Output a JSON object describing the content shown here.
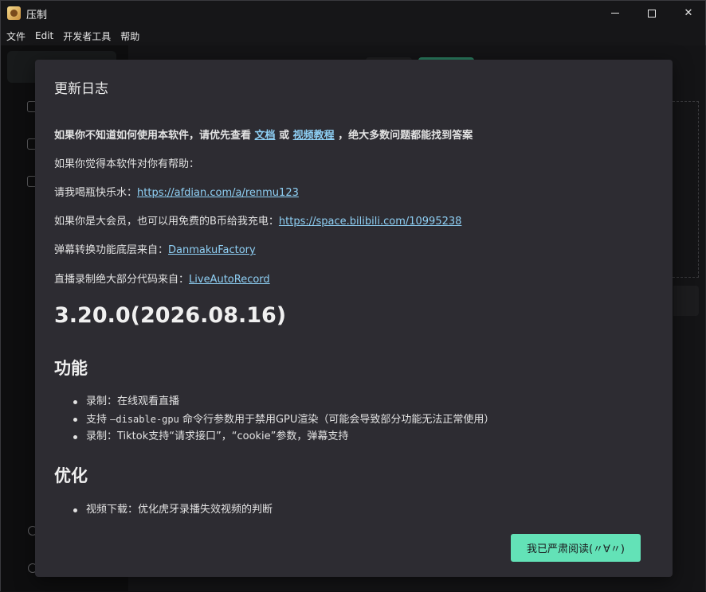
{
  "window": {
    "title": "压制",
    "minimize_label": "minimize",
    "maximize_label": "maximize",
    "close_label": "✕"
  },
  "menu": [
    "文件",
    "Edit",
    "开发者工具",
    "帮助"
  ],
  "modal": {
    "title": "更新日志",
    "intro": {
      "prefix": "如果你不知道如何使用本软件，请优先查看 ",
      "link1": "文档",
      "middle": " 或 ",
      "link2": "视频教程",
      "suffix": " ，绝大多数问题都能找到答案"
    },
    "help_line": "如果你觉得本软件对你有帮助：",
    "donate": {
      "label": "请我喝瓶快乐水：",
      "url": "https://afdian.com/a/renmu123"
    },
    "charge": {
      "label": "如果你是大会员，也可以用免费的B币给我充电：",
      "url": "https://space.bilibili.com/10995238"
    },
    "danmaku": {
      "label": "弹幕转换功能底层来自：",
      "link": "DanmakuFactory"
    },
    "record": {
      "label": "直播录制绝大部分代码来自：",
      "link": "LiveAutoRecord"
    },
    "version": "3.20.0(2026.08.16)",
    "features_heading": "功能",
    "features": [
      {
        "pre": "录制：在线观看直播",
        "code": "",
        "post": ""
      },
      {
        "pre": "支持 ",
        "code": "—disable-gpu",
        "post": " 命令行参数用于禁用GPU渲染（可能会导致部分功能无法正常使用）"
      },
      {
        "pre": "录制：Tiktok支持“请求接口”，“cookie”参数，弹幕支持",
        "code": "",
        "post": ""
      }
    ],
    "optimize_heading": "优化",
    "optimizations": [
      "视频下载：优化虎牙录播失效视频的判断"
    ],
    "ok_button": "我已严肃阅读(〃∀〃)"
  },
  "colors": {
    "accent": "#63e2b7",
    "link": "#8fd0f5",
    "modal_bg": "#2d2c32"
  }
}
